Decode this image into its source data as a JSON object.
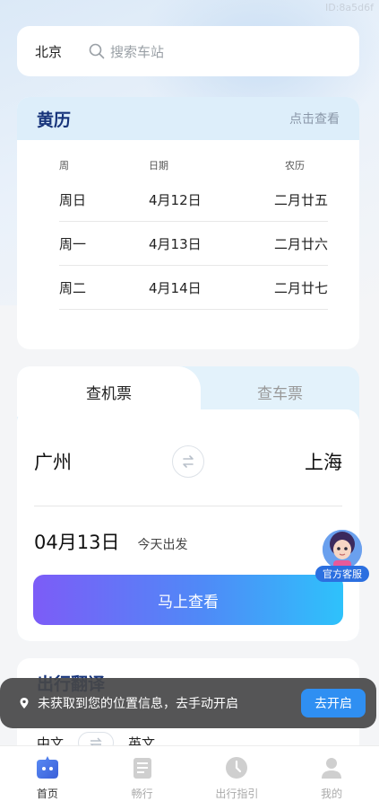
{
  "watermark": "ID:8a5d6f",
  "search": {
    "city": "北京",
    "placeholder": "搜索车站"
  },
  "almanac": {
    "title": "黄历",
    "link": "点击查看",
    "headers": [
      "周",
      "日期",
      "农历"
    ],
    "rows": [
      [
        "周日",
        "4月12日",
        "二月廿五"
      ],
      [
        "周一",
        "4月13日",
        "二月廿六"
      ],
      [
        "周二",
        "4月14日",
        "二月廿七"
      ]
    ]
  },
  "ticket": {
    "tabs": [
      "查机票",
      "查车票"
    ],
    "from": "广州",
    "to": "上海",
    "date": "04月13日",
    "date_sub": "今天出发",
    "submit": "马上查看",
    "service_label": "官方客服"
  },
  "translate": {
    "title": "出行翻译",
    "from_lang": "中文",
    "to_lang": "英文"
  },
  "toast": {
    "message": "未获取到您的位置信息，去手动开启",
    "button": "去开启"
  },
  "tabbar": [
    {
      "label": "首页",
      "icon": "home-robot-icon",
      "active": true
    },
    {
      "label": "畅行",
      "icon": "document-icon",
      "active": false
    },
    {
      "label": "出行指引",
      "icon": "clock-icon",
      "active": false
    },
    {
      "label": "我的",
      "icon": "user-icon",
      "active": false
    }
  ],
  "colors": {
    "accent": "#2f8ff2",
    "title": "#16337a",
    "button_gradient": [
      "#7c5cf7",
      "#2ec2fb"
    ]
  }
}
